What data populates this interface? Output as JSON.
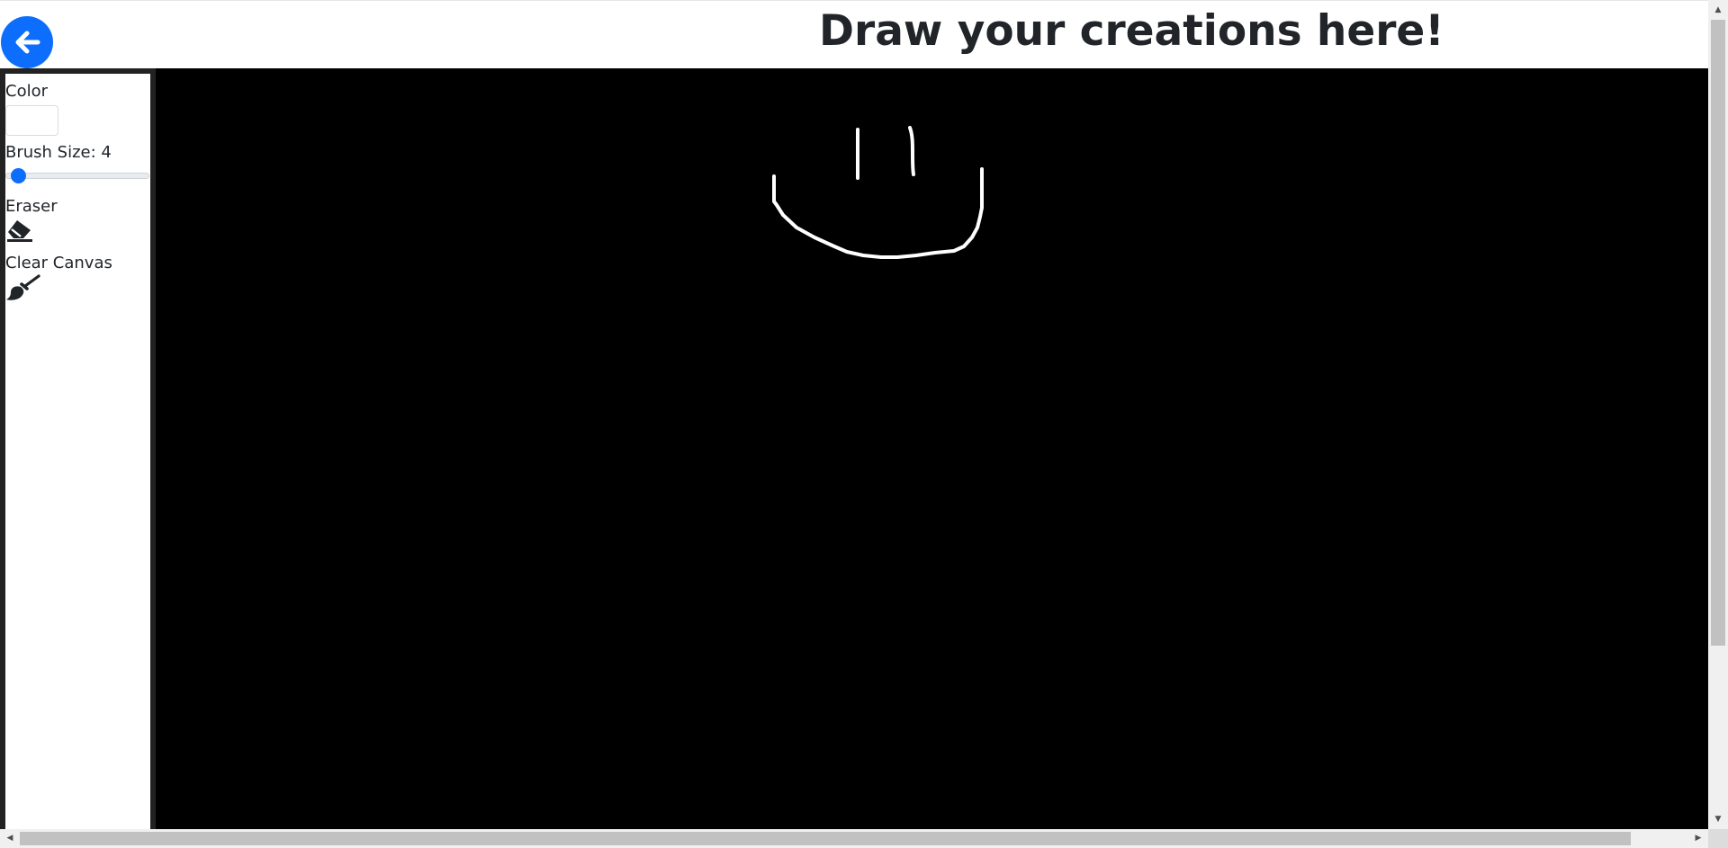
{
  "header": {
    "title": "Draw your creations here!",
    "back_icon": "arrow-left-icon"
  },
  "sidebar": {
    "color_label": "Color",
    "color_value": "#ffffff",
    "brush_label": "Brush Size: 4",
    "brush_size": 4,
    "brush_min": 1,
    "brush_max": 100,
    "eraser_label": "Eraser",
    "eraser_icon": "eraser-icon",
    "clear_label": "Clear Canvas",
    "clear_icon": "paint-brush-icon"
  },
  "canvas": {
    "background": "#000000",
    "stroke_color": "#ffffff"
  },
  "colors": {
    "accent": "#0d6efd",
    "frame": "#222222"
  }
}
